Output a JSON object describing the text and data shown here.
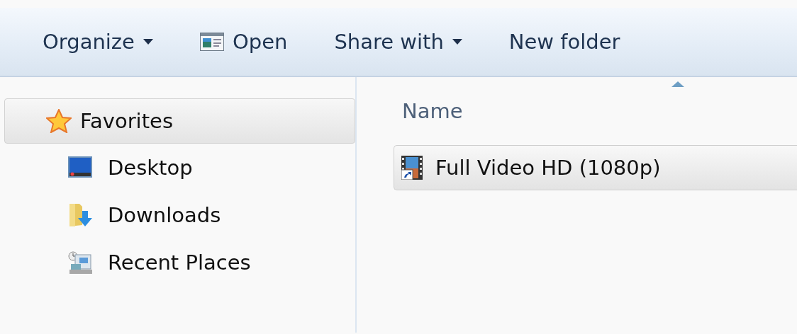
{
  "toolbar": {
    "buttons": [
      {
        "label": "Organize",
        "kind": "menu"
      },
      {
        "label": "Open",
        "kind": "icon"
      },
      {
        "label": "Share with",
        "kind": "menu"
      },
      {
        "label": "New folder",
        "kind": "plain"
      }
    ]
  },
  "sidebar": {
    "groups": [
      {
        "label": "Favorites",
        "selected": true,
        "children": [
          {
            "label": "Desktop",
            "kind": "desktop",
            "selected": false
          },
          {
            "label": "Downloads",
            "kind": "downloads",
            "selected": false
          },
          {
            "label": "Recent Places",
            "kind": "recent",
            "selected": false
          }
        ]
      }
    ]
  },
  "file_list": {
    "columns": [
      {
        "label": "Name",
        "sorted": true
      }
    ],
    "rows": [
      {
        "name": "Full Video HD (1080p)",
        "selected": true
      }
    ]
  }
}
